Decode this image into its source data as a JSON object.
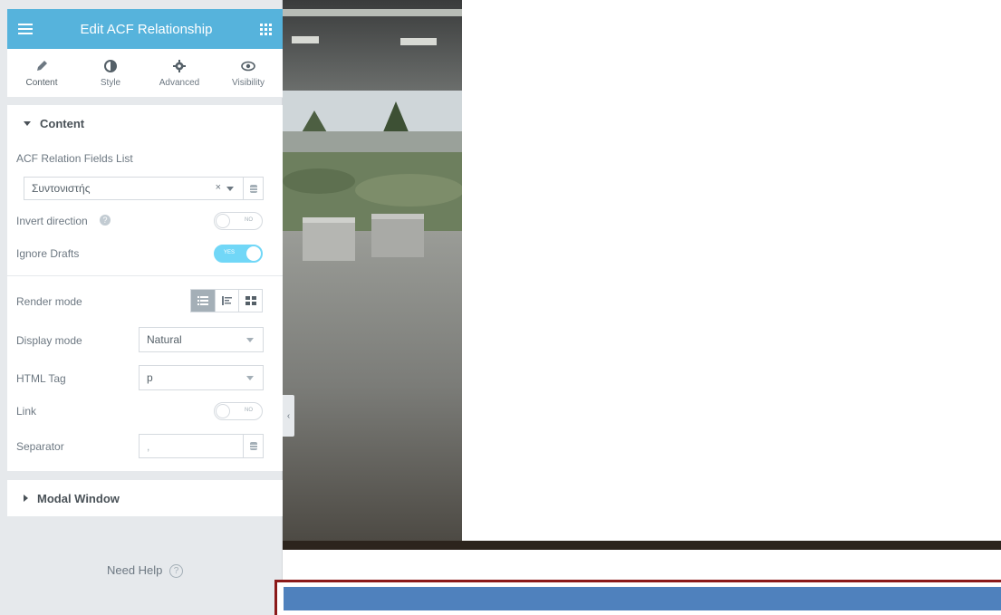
{
  "panel": {
    "title": "Edit ACF Relationship",
    "tabs": [
      {
        "label": "Content",
        "icon": "pencil-icon",
        "active": true
      },
      {
        "label": "Style",
        "icon": "half-circle-icon",
        "active": false
      },
      {
        "label": "Advanced",
        "icon": "gear-icon",
        "active": false
      },
      {
        "label": "Visibility",
        "icon": "eye-icon",
        "active": false
      }
    ],
    "content_section": {
      "label": "Content",
      "fields_list_label": "ACF Relation Fields List",
      "fields_list_value": "Συντονιστής",
      "fields_list_clear": "×",
      "invert_direction_label": "Invert direction",
      "invert_direction_state": "NO",
      "ignore_drafts_label": "Ignore Drafts",
      "ignore_drafts_state": "YES",
      "render_mode_label": "Render mode",
      "display_mode_label": "Display mode",
      "display_mode_value": "Natural",
      "html_tag_label": "HTML Tag",
      "html_tag_value": "p",
      "link_label": "Link",
      "link_state": "NO",
      "separator_label": "Separator",
      "separator_value": ","
    },
    "modal_section": {
      "label": "Modal Window"
    },
    "help": {
      "label": "Need Help",
      "icon_text": "?"
    }
  },
  "colors": {
    "header_blue": "#56b3dc",
    "toggle_on": "#71d7f7",
    "frame_red": "#8b1a1a",
    "bar_blue": "#4f81bd"
  }
}
